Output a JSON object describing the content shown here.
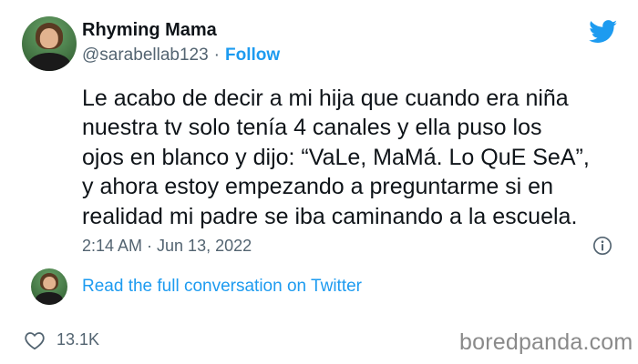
{
  "tweet": {
    "author": {
      "display_name": "Rhyming Mama",
      "handle": "@sarabellab123",
      "separator": "·",
      "follow_label": "Follow"
    },
    "text": "Le acabo de decir a mi hija que cuando era niña\nnuestra tv solo tenía 4 canales y ella puso los\nojos en blanco y dijo: “VaLe, MaMá. Lo QuE SeA”,\ny ahora estoy empezando a preguntarme si en\nrealidad mi padre se iba caminando a la escuela.",
    "timestamp": "2:14 AM · Jun 13, 2022",
    "read_conversation_label": "Read the full conversation on Twitter",
    "like_count": "13.1K"
  },
  "icons": {
    "brand": "twitter-bird-icon",
    "info": "info-icon",
    "like": "heart-icon"
  },
  "colors": {
    "accent": "#1d9bf0",
    "text": "#0f1419",
    "muted": "#536471",
    "watermark": "#8a8a8a"
  },
  "watermark": "boredpanda.com"
}
